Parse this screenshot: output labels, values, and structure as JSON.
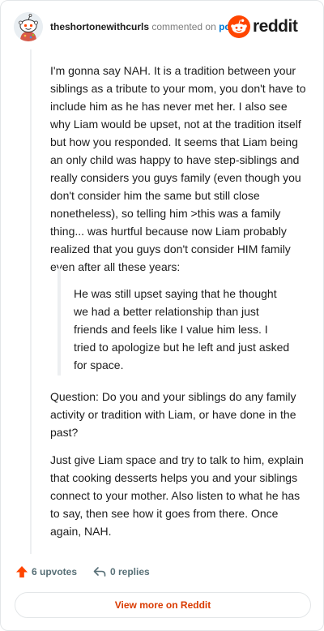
{
  "header": {
    "username": "theshortonewithcurls",
    "action_text": "commented on",
    "post_link": "post",
    "brand_name": "reddit"
  },
  "comment": {
    "paragraph_1": "I'm gonna say NAH. It is a tradition between your siblings as a tribute to your mom, you don't have to include him as he has never met her. I also see why Liam would be upset, not at the tradition itself but how you responded. It seems that Liam being an only child was happy to have step-siblings and really considers you guys family (even though you don't consider him the same but still close nonetheless), so telling him >this was a family thing... was hurtful because now Liam probably realized that you guys don't consider HIM family even after all these years:",
    "quote": "He was still upset saying that he thought we had a better relationship than just friends and feels like I value him less. I tried to apologize but he left and just asked for space.",
    "paragraph_2": "Question: Do you and your siblings do any family activity or tradition with Liam, or have done in the past?",
    "paragraph_3": "Just give Liam space and try to talk to him, explain that cooking desserts helps you and your siblings connect to your mother. Also listen to what he has to say, then see how it goes from there. Once again, NAH."
  },
  "actions": {
    "upvotes_label": "6 upvotes",
    "replies_label": "0 replies"
  },
  "footer": {
    "view_more_label": "View more on Reddit"
  },
  "colors": {
    "brand_orange": "#ff4500",
    "link_blue": "#0079d3",
    "view_more_text": "#d93a00",
    "muted": "#576f76"
  },
  "icons": {
    "avatar": "snoo-avatar",
    "brand": "reddit-logo-icon",
    "upvote": "upvote-arrow-icon",
    "reply": "reply-arrow-icon"
  }
}
